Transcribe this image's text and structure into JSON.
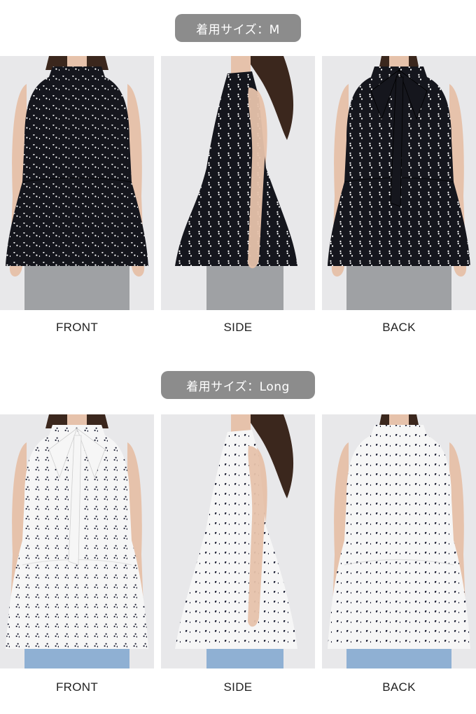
{
  "sections": [
    {
      "size_label": "着用サイズ：M",
      "garment_color": "#15161d",
      "dot_color": "#ffffff",
      "photos": [
        {
          "view": "FRONT",
          "icon": "sleeveless-top-front-photo"
        },
        {
          "view": "SIDE",
          "icon": "sleeveless-top-side-photo"
        },
        {
          "view": "BACK",
          "icon": "sleeveless-top-back-photo"
        }
      ]
    },
    {
      "size_label": "着用サイズ：Long",
      "garment_color": "#f6f6f6",
      "dot_color": "#1c1f33",
      "photos": [
        {
          "view": "FRONT",
          "icon": "sleeveless-top-front-photo"
        },
        {
          "view": "SIDE",
          "icon": "sleeveless-top-side-photo"
        },
        {
          "view": "BACK",
          "icon": "sleeveless-top-back-photo"
        }
      ]
    }
  ]
}
